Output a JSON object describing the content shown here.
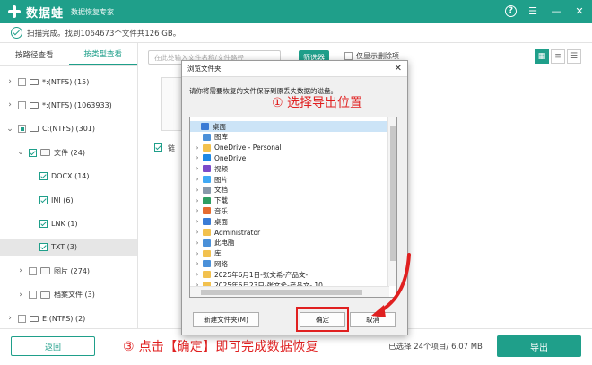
{
  "app": {
    "name": "数据蛙",
    "subtitle": "数据恢复专家"
  },
  "status": {
    "text": "扫描完成。找到1064673个文件共126 GB。"
  },
  "tabs": [
    {
      "label": "按路径查看",
      "active": false
    },
    {
      "label": "按类型查看",
      "active": true
    }
  ],
  "tree": [
    {
      "label": "*:(NTFS) (15)",
      "indent": 0,
      "type": "drive",
      "checked": "none",
      "expanded": false
    },
    {
      "label": "*:(NTFS) (1063933)",
      "indent": 0,
      "type": "drive",
      "checked": "none",
      "expanded": false
    },
    {
      "label": "C:(NTFS) (301)",
      "indent": 0,
      "type": "drive",
      "checked": "partial",
      "expanded": true
    },
    {
      "label": "文件 (24)",
      "indent": 1,
      "type": "folder",
      "checked": "checked",
      "expanded": true
    },
    {
      "label": "DOCX (14)",
      "indent": 2,
      "type": "none",
      "checked": "checked"
    },
    {
      "label": "INI (6)",
      "indent": 2,
      "type": "none",
      "checked": "checked"
    },
    {
      "label": "LNK (1)",
      "indent": 2,
      "type": "none",
      "checked": "checked"
    },
    {
      "label": "TXT (3)",
      "indent": 2,
      "type": "none",
      "checked": "checked",
      "selected": true
    },
    {
      "label": "图片 (274)",
      "indent": 1,
      "type": "folder",
      "checked": "none",
      "expanded": false
    },
    {
      "label": "档案文件 (3)",
      "indent": 1,
      "type": "folder",
      "checked": "none",
      "expanded": false
    },
    {
      "label": "E:(NTFS) (2)",
      "indent": 0,
      "type": "drive",
      "checked": "none",
      "expanded": false
    }
  ],
  "search": {
    "placeholder": "在此处输入文件名称/文件路径"
  },
  "filter_label": "筛选器",
  "deleted_only_label": "仅显示删除项",
  "file_area": {
    "file_name": "链"
  },
  "dialog": {
    "title": "浏览文件夹",
    "description": "请你将需要恢复的文件保存到原丢失数据的磁盘。",
    "annotation": "① 选择导出位置",
    "items": [
      {
        "label": "桌面",
        "icon_color": "#3a7bd5",
        "indent": 0,
        "chevron": false,
        "selected": true
      },
      {
        "label": "图库",
        "icon_color": "#4a90d9",
        "indent": 1,
        "chevron": false
      },
      {
        "label": "OneDrive - Personal",
        "icon_color": "#f2c14e",
        "indent": 1,
        "chevron": true
      },
      {
        "label": "OneDrive",
        "icon_color": "#1e88e5",
        "indent": 1,
        "chevron": true
      },
      {
        "label": "视频",
        "icon_color": "#7b4bc9",
        "indent": 1,
        "chevron": true
      },
      {
        "label": "图片",
        "icon_color": "#3fa9f5",
        "indent": 1,
        "chevron": true
      },
      {
        "label": "文档",
        "icon_color": "#8899aa",
        "indent": 1,
        "chevron": true
      },
      {
        "label": "下载",
        "icon_color": "#2e9e62",
        "indent": 1,
        "chevron": true
      },
      {
        "label": "音乐",
        "icon_color": "#e56b2f",
        "indent": 1,
        "chevron": true
      },
      {
        "label": "桌面",
        "icon_color": "#3a7bd5",
        "indent": 1,
        "chevron": true
      },
      {
        "label": "Administrator",
        "icon_color": "#f2c14e",
        "indent": 1,
        "chevron": true
      },
      {
        "label": "此电脑",
        "icon_color": "#4a90d9",
        "indent": 1,
        "chevron": true
      },
      {
        "label": "库",
        "icon_color": "#f2c14e",
        "indent": 1,
        "chevron": true
      },
      {
        "label": "网络",
        "icon_color": "#4a90d9",
        "indent": 1,
        "chevron": true
      },
      {
        "label": "2025年6月1日-张文希-产品文-",
        "icon_color": "#f2c14e",
        "indent": 1,
        "chevron": true
      },
      {
        "label": "2025年6月23日-张文希-产品文- 10",
        "icon_color": "#f2c14e",
        "indent": 1,
        "chevron": true
      }
    ],
    "new_folder_label": "新建文件夹(M)",
    "ok_label": "确定",
    "cancel_label": "取消"
  },
  "bottom": {
    "back_label": "返回",
    "annotation": "③ 点击【确定】即可完成数据恢复",
    "selected_info": "已选择 24个项目/ 6.07 MB",
    "export_label": "导出"
  },
  "colors": {
    "brand": "#1f9f8a",
    "annotation": "#e02020"
  }
}
